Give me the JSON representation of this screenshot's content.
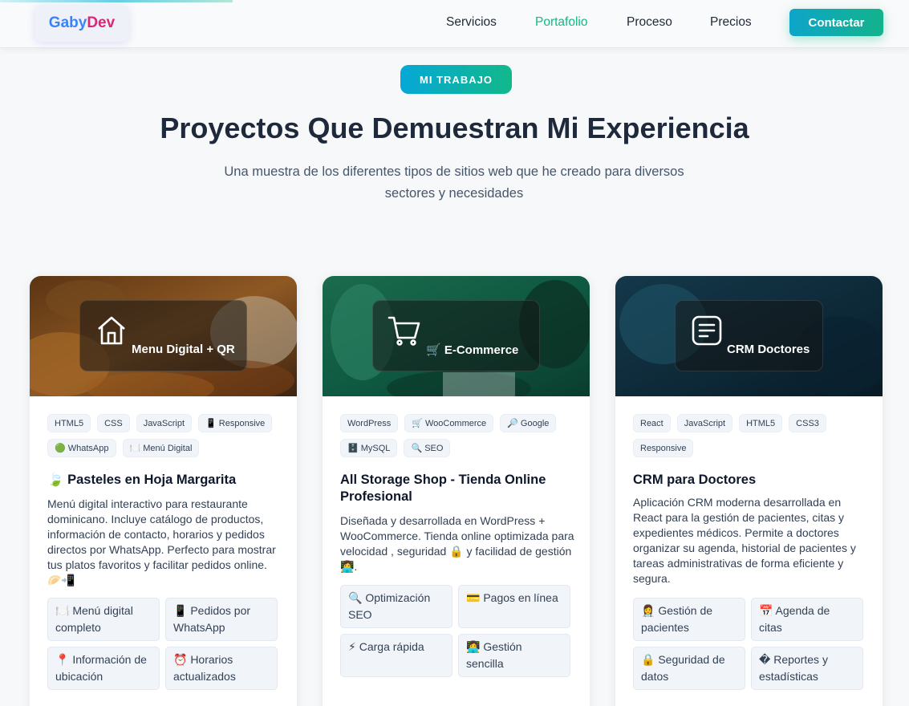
{
  "header": {
    "logo_a": "Gaby",
    "logo_b": "Dev",
    "nav": [
      "Servicios",
      "Portafolio",
      "Proceso",
      "Precios"
    ],
    "cta": "Contactar"
  },
  "hero": {
    "badge": "MI TRABAJO",
    "title": "Proyectos Que Demuestran Mi Experiencia",
    "subtitle": "Una muestra de los diferentes tipos de sitios web que he creado para diversos sectores y necesidades"
  },
  "cards": [
    {
      "overlay_label": "Menu Digital + QR",
      "overlay_icon": "home-icon",
      "tags": [
        "HTML5",
        "CSS",
        "JavaScript",
        "📱 Responsive",
        "🟢 WhatsApp",
        "🍽️ Menú Digital"
      ],
      "title": "🍃 Pasteles en Hoja Margarita",
      "description": "Menú digital interactivo para restaurante dominicano. Incluye catálogo de productos, información de contacto, horarios y pedidos directos por WhatsApp. Perfecto para mostrar tus platos favoritos y facilitar pedidos online. 🥟📲",
      "features": [
        "🍽️ Menú digital completo",
        "📱 Pedidos por WhatsApp",
        "📍 Información de ubicación",
        "⏰ Horarios actualizados"
      ]
    },
    {
      "overlay_label": "🛒 E-Commerce",
      "overlay_icon": "cart-icon",
      "tags": [
        "WordPress",
        "🛒 WooCommerce",
        "🔎 Google",
        "🗄️ MySQL",
        "🔍 SEO"
      ],
      "title": "All Storage Shop - Tienda Online Profesional",
      "description": "Diseñada y desarrollada en WordPress + WooCommerce. Tienda online optimizada para velocidad , seguridad 🔒 y facilidad de gestión 👩‍💻.",
      "features": [
        "🔍 Optimización SEO",
        "💳 Pagos en línea",
        "⚡ Carga rápida",
        "👩‍💻 Gestión sencilla"
      ]
    },
    {
      "overlay_label": "CRM Doctores",
      "overlay_icon": "document-icon",
      "tags": [
        "React",
        "JavaScript",
        "HTML5",
        "CSS3",
        "Responsive"
      ],
      "title": "CRM para Doctores",
      "description": "Aplicación CRM moderna desarrollada en React para la gestión de pacientes, citas y expedientes médicos. Permite a doctores organizar su agenda, historial de pacientes y tareas administrativas de forma eficiente y segura.",
      "features": [
        "👩‍⚕️ Gestión de pacientes",
        "📅 Agenda de citas",
        "🔒 Seguridad de datos",
        "� Reportes y estadísticas"
      ]
    }
  ],
  "colors": {
    "accent_green": "#10b981",
    "accent_cyan": "#06b6d4",
    "title_dark": "#1e293b"
  }
}
